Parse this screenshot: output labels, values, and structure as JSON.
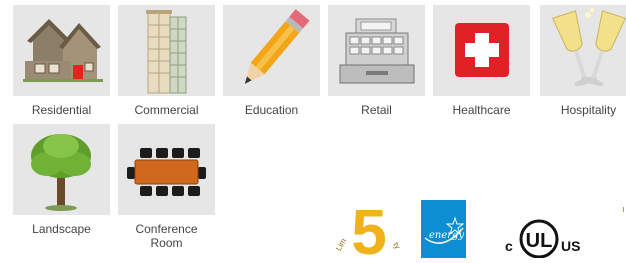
{
  "categories": [
    {
      "label": "Residential",
      "icon": "house-icon"
    },
    {
      "label": "Commercial",
      "icon": "office-building-icon"
    },
    {
      "label": "Education",
      "icon": "pencil-icon"
    },
    {
      "label": "Retail",
      "icon": "cash-register-icon"
    },
    {
      "label": "Healthcare",
      "icon": "medical-cross-icon"
    },
    {
      "label": "Hospitality",
      "icon": "champagne-glasses-icon"
    },
    {
      "label": "Landscape",
      "icon": "tree-icon"
    },
    {
      "label": "Conference Room",
      "icon": "conference-table-icon"
    }
  ],
  "certifications": {
    "warranty": {
      "number": "5",
      "left_text": "Lim",
      "right_text": "ty",
      "icon": "five-year-warranty-badge"
    },
    "energy_star": {
      "script": "energy",
      "icon": "energy-star-logo"
    },
    "ul": {
      "c": "c",
      "ul": "UL",
      "us": "US",
      "icon": "cul-us-listed-logo"
    }
  },
  "colors": {
    "tile_bg": "#e6e6e6",
    "energy_star_blue": "#0d8ed2",
    "healthcare_red": "#e02126",
    "accent_green": "#7ac142"
  }
}
